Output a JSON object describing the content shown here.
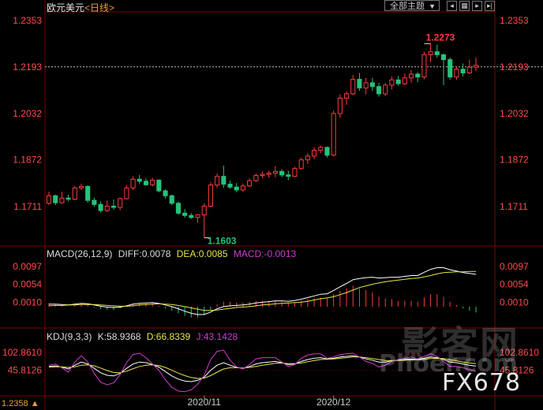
{
  "header": {
    "symbol": "欧元美元",
    "period": "<日线>",
    "theme_button": "全部主题",
    "theme_arrow": "▼",
    "tool_icons": [
      "prev-icon",
      "grid-icon",
      "next-icon",
      "next-end-icon"
    ]
  },
  "colors": {
    "up": "#ff3b3b",
    "down": "#27c27a",
    "diff_line": "#ffffff",
    "dea_line": "#e6e64a",
    "macd_label": "#d23bd2",
    "k_line": "#ffffff",
    "d_line": "#e6e64a",
    "j_line": "#d23bd2",
    "price_axis": "#ff4a4a",
    "grid": "#7a0000"
  },
  "price_panel": {
    "y_ticks": [
      "1.2353",
      "1.2193",
      "1.2032",
      "1.1872",
      "1.1711"
    ],
    "high_label": "1.2273",
    "low_label": "1.1603"
  },
  "macd_panel": {
    "label": "MACD(26,12,9)",
    "diff": "DIFF:0.0078",
    "dea": "DEA:0.0085",
    "macd": "MACD:-0.0013",
    "y_ticks": [
      "0.0097",
      "0.0054",
      "0.0010"
    ]
  },
  "kdj_panel": {
    "label": "KDJ(9,3,3)",
    "k": "K:58.9368",
    "d": "D:66.8339",
    "j": "J:43.1428",
    "y_ticks": [
      "102.8610",
      "45.8126"
    ]
  },
  "x_axis": {
    "labels": [
      "2020/11",
      "2020/12"
    ]
  },
  "corner": "1.2358 ▲",
  "watermark": {
    "cn": "影客网",
    "url": "Phoer.com",
    "fx": "FX678"
  },
  "chart_data": {
    "type": "candlestick",
    "ohlc": [
      [
        1.1722,
        1.1762,
        1.1716,
        1.1748
      ],
      [
        1.1748,
        1.1752,
        1.1716,
        1.1724
      ],
      [
        1.1724,
        1.1762,
        1.172,
        1.174
      ],
      [
        1.174,
        1.1752,
        1.1728,
        1.1736
      ],
      [
        1.1736,
        1.1782,
        1.1732,
        1.1775
      ],
      [
        1.1775,
        1.179,
        1.1768,
        1.178
      ],
      [
        1.178,
        1.1785,
        1.1724,
        1.1732
      ],
      [
        1.1732,
        1.1742,
        1.171,
        1.1718
      ],
      [
        1.1718,
        1.1728,
        1.169,
        1.1697
      ],
      [
        1.1697,
        1.1732,
        1.1692,
        1.1712
      ],
      [
        1.1712,
        1.1735,
        1.17,
        1.1708
      ],
      [
        1.1708,
        1.1742,
        1.1698,
        1.1738
      ],
      [
        1.1738,
        1.1785,
        1.1735,
        1.1775
      ],
      [
        1.1775,
        1.1815,
        1.1768,
        1.1805
      ],
      [
        1.1805,
        1.182,
        1.1788,
        1.1798
      ],
      [
        1.1798,
        1.1808,
        1.1782,
        1.1786
      ],
      [
        1.1786,
        1.181,
        1.178,
        1.1802
      ],
      [
        1.1802,
        1.1805,
        1.176,
        1.1765
      ],
      [
        1.1765,
        1.177,
        1.1738,
        1.1748
      ],
      [
        1.1748,
        1.1752,
        1.1715,
        1.1722
      ],
      [
        1.1722,
        1.1728,
        1.1682,
        1.1688
      ],
      [
        1.1688,
        1.1702,
        1.1672,
        1.168
      ],
      [
        1.168,
        1.1688,
        1.1668,
        1.1673
      ],
      [
        1.1673,
        1.1685,
        1.1655,
        1.1682
      ],
      [
        1.1682,
        1.1722,
        1.1603,
        1.1712
      ],
      [
        1.1712,
        1.1795,
        1.1708,
        1.1785
      ],
      [
        1.1785,
        1.1825,
        1.1775,
        1.1815
      ],
      [
        1.1815,
        1.1852,
        1.1775,
        1.1788
      ],
      [
        1.1788,
        1.18,
        1.1772,
        1.1778
      ],
      [
        1.1778,
        1.1792,
        1.176,
        1.1768
      ],
      [
        1.1768,
        1.179,
        1.1762,
        1.1782
      ],
      [
        1.1782,
        1.1808,
        1.1778,
        1.18
      ],
      [
        1.18,
        1.1825,
        1.1795,
        1.1818
      ],
      [
        1.1818,
        1.1832,
        1.1808,
        1.1822
      ],
      [
        1.1822,
        1.1835,
        1.181,
        1.1826
      ],
      [
        1.1826,
        1.185,
        1.1812,
        1.1832
      ],
      [
        1.1832,
        1.184,
        1.1812,
        1.182
      ],
      [
        1.182,
        1.1835,
        1.1802,
        1.1815
      ],
      [
        1.1815,
        1.1848,
        1.1812,
        1.1842
      ],
      [
        1.1842,
        1.188,
        1.1838,
        1.1872
      ],
      [
        1.1872,
        1.1895,
        1.1858,
        1.1885
      ],
      [
        1.1885,
        1.1915,
        1.1875,
        1.1905
      ],
      [
        1.1905,
        1.1922,
        1.1895,
        1.1915
      ],
      [
        1.1915,
        1.1918,
        1.188,
        1.1888
      ],
      [
        1.1888,
        1.2042,
        1.1884,
        1.2032
      ],
      [
        1.2032,
        1.2098,
        1.2018,
        1.2085
      ],
      [
        1.2085,
        1.2108,
        1.2062,
        1.21
      ],
      [
        1.21,
        1.2165,
        1.2095,
        1.215
      ],
      [
        1.215,
        1.2172,
        1.211,
        1.212
      ],
      [
        1.212,
        1.2155,
        1.2098,
        1.2138
      ],
      [
        1.2138,
        1.2155,
        1.211,
        1.2125
      ],
      [
        1.2125,
        1.2138,
        1.209,
        1.21
      ],
      [
        1.21,
        1.2138,
        1.2092,
        1.213
      ],
      [
        1.213,
        1.216,
        1.2115,
        1.2148
      ],
      [
        1.2148,
        1.2162,
        1.2128,
        1.2135
      ],
      [
        1.2135,
        1.217,
        1.213,
        1.2155
      ],
      [
        1.2155,
        1.2182,
        1.2138,
        1.2168
      ],
      [
        1.2168,
        1.2175,
        1.214,
        1.2158
      ],
      [
        1.2158,
        1.2245,
        1.215,
        1.2235
      ],
      [
        1.2235,
        1.2273,
        1.221,
        1.2245
      ],
      [
        1.2245,
        1.227,
        1.2225,
        1.2235
      ],
      [
        1.2235,
        1.2238,
        1.213,
        1.2218
      ],
      [
        1.2218,
        1.2225,
        1.2148,
        1.2158
      ],
      [
        1.2158,
        1.2195,
        1.2148,
        1.2185
      ],
      [
        1.2185,
        1.2205,
        1.216,
        1.2172
      ],
      [
        1.2172,
        1.2218,
        1.2168,
        1.2192
      ],
      [
        1.2192,
        1.2225,
        1.2178,
        1.2198
      ]
    ],
    "price_range": [
      1.158,
      1.2383
    ],
    "macd": {
      "range": [
        -0.004,
        0.0112
      ],
      "diff": [
        0.0006,
        0.0006,
        0.0005,
        0.0004,
        0.0006,
        0.0008,
        0.0007,
        0.0004,
        0.0001,
        -0.0001,
        -0.0002,
        -0.0001,
        0.0002,
        0.0006,
        0.0008,
        0.0009,
        0.001,
        0.0008,
        0.0004,
        0.0,
        -0.0005,
        -0.0011,
        -0.0016,
        -0.0019,
        -0.0019,
        -0.0013,
        -0.0005,
        0.0,
        0.0002,
        0.0003,
        0.0004,
        0.0006,
        0.0009,
        0.0011,
        0.0012,
        0.0014,
        0.0014,
        0.0013,
        0.0015,
        0.0018,
        0.0022,
        0.0026,
        0.003,
        0.0031,
        0.0039,
        0.0048,
        0.0056,
        0.0065,
        0.0068,
        0.007,
        0.0071,
        0.0069,
        0.007,
        0.0071,
        0.0071,
        0.0073,
        0.0075,
        0.0075,
        0.0083,
        0.009,
        0.0094,
        0.0094,
        0.0089,
        0.0086,
        0.0082,
        0.008,
        0.0078
      ],
      "dea": [
        0.0002,
        0.0003,
        0.0003,
        0.0004,
        0.0004,
        0.0005,
        0.0005,
        0.0005,
        0.0004,
        0.0003,
        0.0002,
        0.0001,
        0.0001,
        0.0002,
        0.0004,
        0.0005,
        0.0006,
        0.0007,
        0.0006,
        0.0005,
        0.0003,
        0.0,
        -0.0003,
        -0.0006,
        -0.0009,
        -0.0009,
        -0.0008,
        -0.0006,
        -0.0004,
        -0.0002,
        -0.0001,
        0.0,
        0.0002,
        0.0004,
        0.0005,
        0.0007,
        0.0008,
        0.0009,
        0.001,
        0.0011,
        0.0013,
        0.0016,
        0.0019,
        0.0021,
        0.0024,
        0.0029,
        0.0034,
        0.004,
        0.0046,
        0.005,
        0.0054,
        0.0057,
        0.006,
        0.0062,
        0.0064,
        0.0066,
        0.0068,
        0.0069,
        0.0072,
        0.0075,
        0.0079,
        0.0082,
        0.0083,
        0.0084,
        0.0084,
        0.0085,
        0.0085
      ]
    },
    "kdj": {
      "range": [
        -30,
        140
      ],
      "k": [
        58,
        60,
        56,
        50,
        62,
        72,
        66,
        52,
        38,
        30,
        28,
        36,
        52,
        66,
        72,
        70,
        64,
        56,
        42,
        28,
        18,
        12,
        10,
        14,
        24,
        46,
        62,
        70,
        62,
        55,
        52,
        58,
        66,
        70,
        72,
        74,
        70,
        64,
        66,
        74,
        80,
        84,
        86,
        82,
        84,
        88,
        90,
        92,
        88,
        82,
        78,
        72,
        72,
        76,
        78,
        80,
        82,
        80,
        84,
        88,
        86,
        80,
        72,
        70,
        66,
        62,
        58.9368
      ],
      "d": [
        56,
        57,
        57,
        55,
        57,
        62,
        63,
        60,
        53,
        45,
        39,
        38,
        43,
        51,
        58,
        62,
        63,
        61,
        55,
        46,
        37,
        29,
        23,
        20,
        21,
        29,
        40,
        50,
        54,
        54,
        53,
        55,
        58,
        62,
        65,
        68,
        69,
        67,
        67,
        69,
        73,
        77,
        80,
        81,
        82,
        84,
        86,
        88,
        88,
        86,
        83,
        80,
        77,
        77,
        77,
        78,
        79,
        79,
        81,
        83,
        84,
        83,
        79,
        76,
        72,
        69,
        66.8339
      ],
      "j": [
        62,
        66,
        54,
        40,
        72,
        92,
        72,
        36,
        8,
        0,
        6,
        32,
        70,
        96,
        100,
        86,
        66,
        46,
        16,
        -8,
        -20,
        -22,
        -16,
        2,
        30,
        80,
        106,
        110,
        78,
        57,
        50,
        64,
        82,
        86,
        86,
        86,
        72,
        58,
        64,
        84,
        94,
        98,
        98,
        84,
        88,
        96,
        98,
        100,
        88,
        74,
        68,
        56,
        62,
        74,
        80,
        84,
        88,
        82,
        90,
        98,
        90,
        74,
        58,
        58,
        54,
        48,
        43.1428
      ]
    },
    "xlabels": [
      "2020/11",
      "2020/12"
    ],
    "xlabel_index": [
      24,
      44
    ],
    "grid": true
  }
}
